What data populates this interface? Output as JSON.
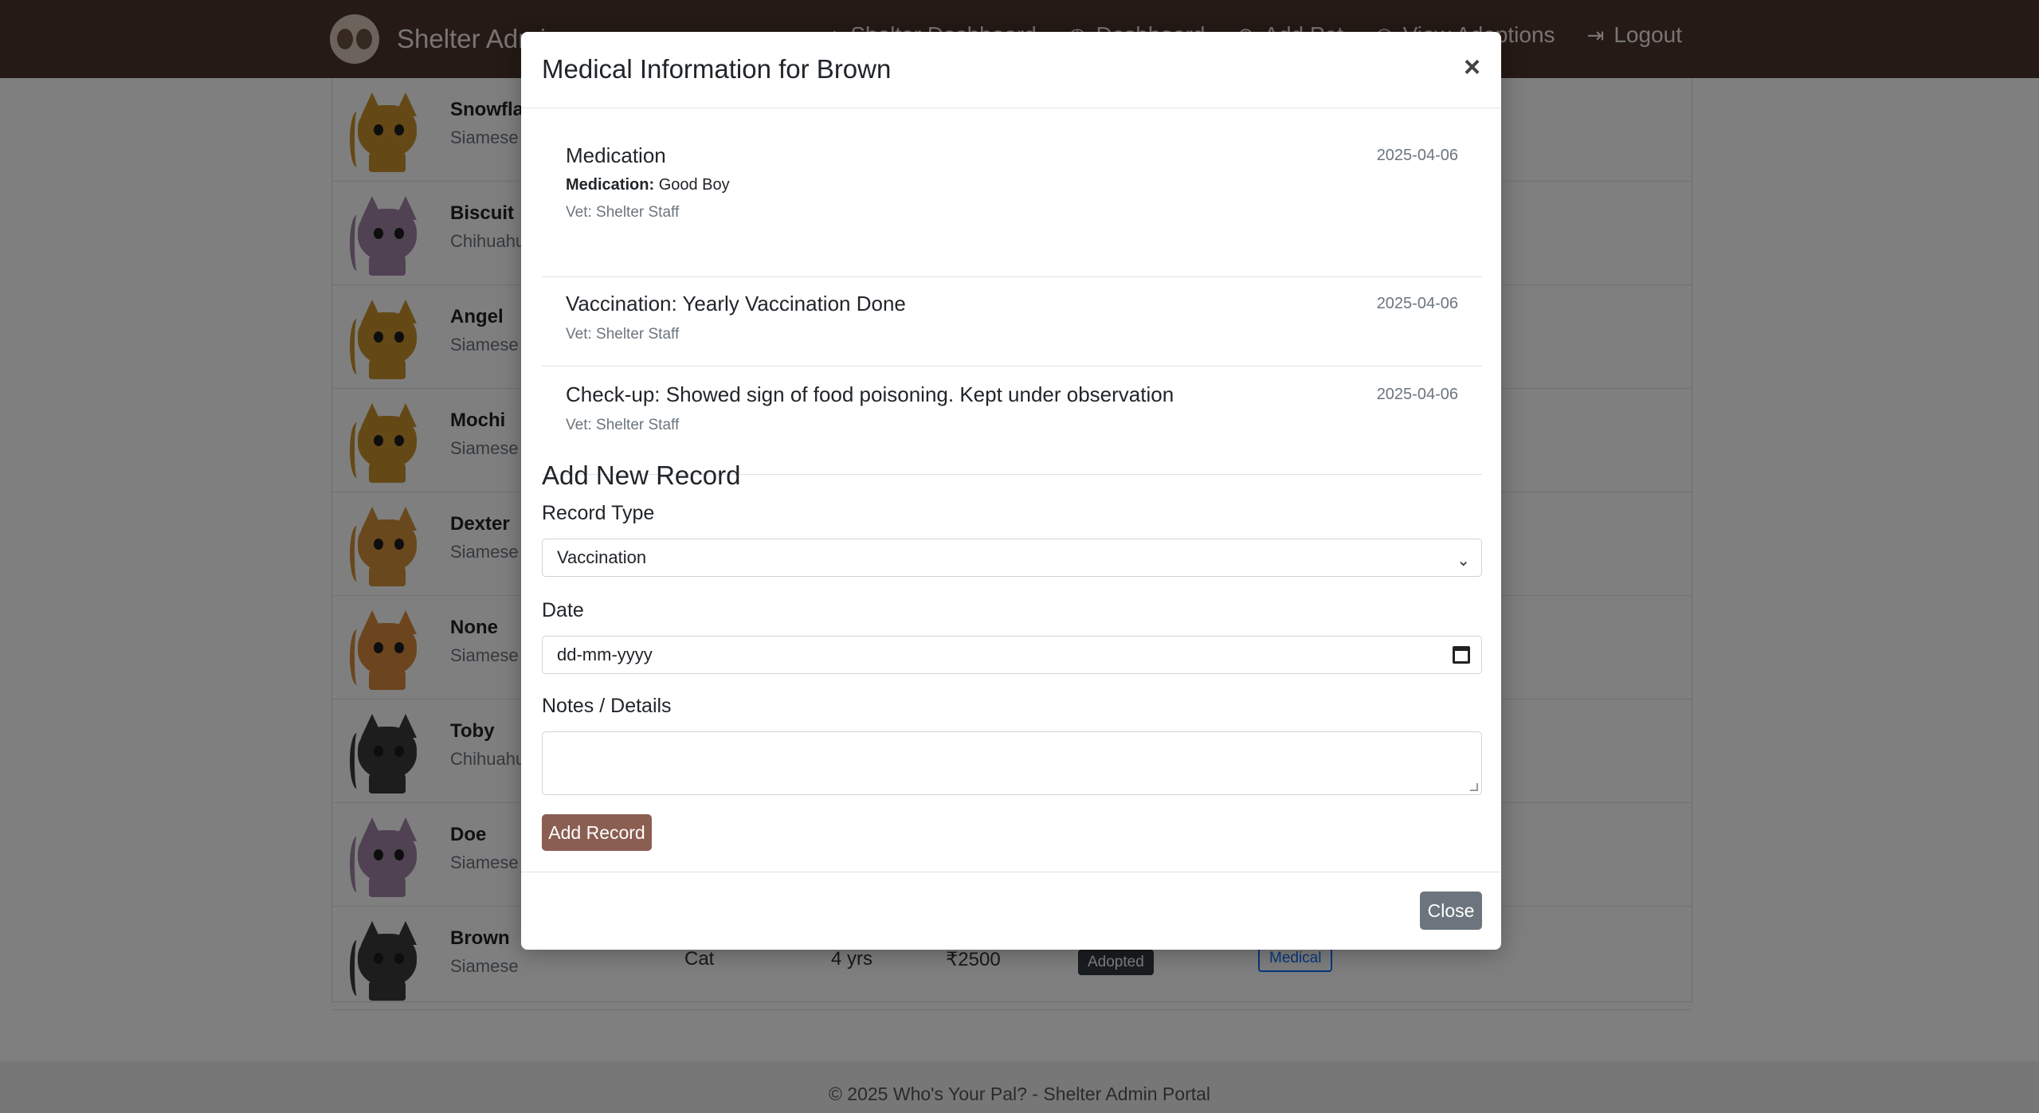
{
  "navbar": {
    "brand": "Shelter Admin",
    "items": [
      {
        "icon": "home-icon",
        "glyph": "⌂",
        "label": "Shelter Dashboard"
      },
      {
        "icon": "dashboard-icon",
        "glyph": "◷",
        "label": "Dashboard"
      },
      {
        "icon": "add-icon",
        "glyph": "⊕",
        "label": "Add Pet"
      },
      {
        "icon": "adoptions-icon",
        "glyph": "◎",
        "label": "View Adoptions"
      },
      {
        "icon": "logout-icon",
        "glyph": "⇥",
        "label": "Logout"
      }
    ]
  },
  "pets": [
    {
      "name": "Snowflake",
      "breed": "Siamese",
      "color": "#c8922e"
    },
    {
      "name": "Biscuit",
      "breed": "Chihuahua",
      "color": "#a084a6"
    },
    {
      "name": "Angel",
      "breed": "Siamese",
      "color": "#c8922e"
    },
    {
      "name": "Mochi",
      "breed": "Siamese",
      "color": "#c8922e"
    },
    {
      "name": "Dexter",
      "breed": "Siamese",
      "color": "#d3913b"
    },
    {
      "name": "None",
      "breed": "Siamese",
      "color": "#d88b3e"
    },
    {
      "name": "Toby",
      "breed": "Chihuahua",
      "color": "#3b3b3b"
    },
    {
      "name": "Doe",
      "breed": "Siamese",
      "color": "#a084a6"
    },
    {
      "name": "Brown",
      "breed": "Siamese",
      "color": "#3b3b3b",
      "type": "Cat",
      "age": "4 yrs",
      "price": "₹2500",
      "status": "Adopted",
      "action": "Medical"
    }
  ],
  "footer": "© 2025 Who's Your Pal? - Shelter Admin Portal",
  "modal": {
    "title": "Medical Information for Brown",
    "close_glyph": "×",
    "records": [
      {
        "title": "Medication",
        "date": "2025-04-06",
        "detail_label": "Medication:",
        "detail_value": "Good Boy",
        "vet": "Vet: Shelter Staff"
      },
      {
        "title": "Vaccination: Yearly Vaccination Done",
        "date": "2025-04-06",
        "vet": "Vet: Shelter Staff"
      },
      {
        "title": "Check-up: Showed sign of food poisoning. Kept under observation",
        "date": "2025-04-06",
        "vet": "Vet: Shelter Staff"
      }
    ],
    "form": {
      "section_title": "Add New Record",
      "record_type_label": "Record Type",
      "record_type_value": "Vaccination",
      "date_label": "Date",
      "date_placeholder": "dd-mm-yyyy",
      "notes_label": "Notes / Details",
      "notes_value": "",
      "submit_label": "Add Record"
    },
    "close_label": "Close"
  }
}
